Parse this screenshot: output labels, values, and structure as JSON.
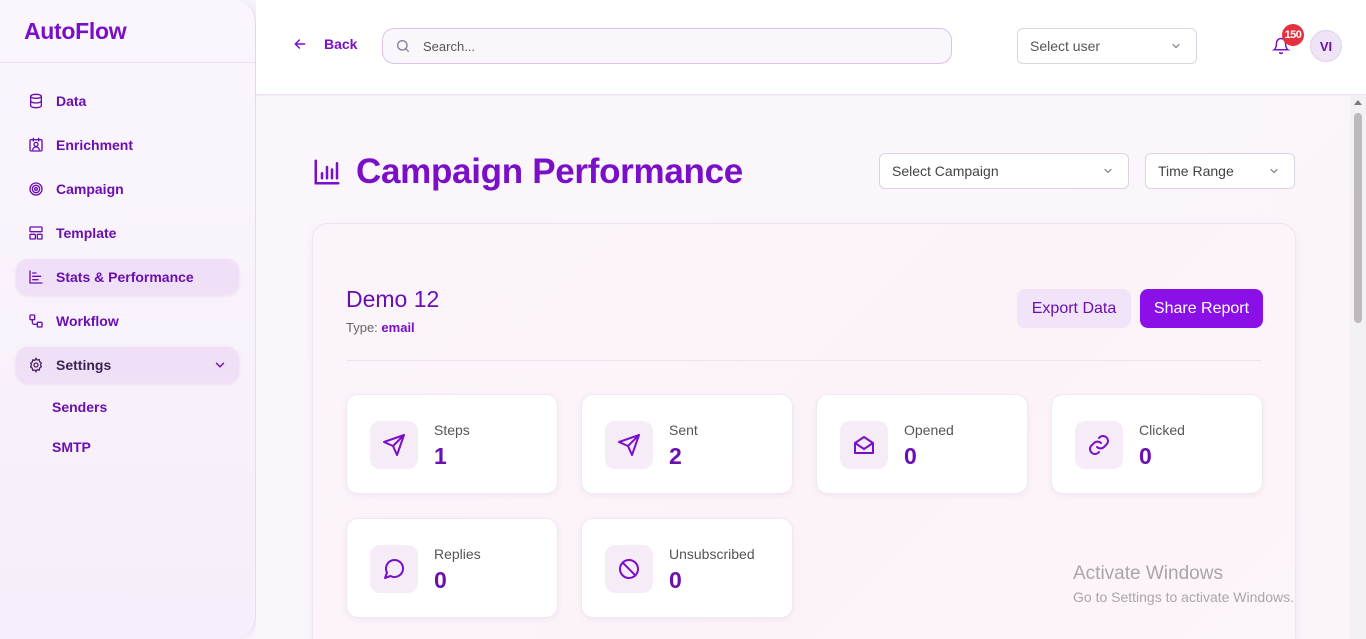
{
  "app": {
    "title": "AutoFlow"
  },
  "sidebar": {
    "items": [
      {
        "label": "Data",
        "icon": "database-icon"
      },
      {
        "label": "Enrichment",
        "icon": "id-card-icon"
      },
      {
        "label": "Campaign",
        "icon": "target-icon"
      },
      {
        "label": "Template",
        "icon": "layout-icon"
      },
      {
        "label": "Stats & Performance",
        "icon": "bar-chart-icon",
        "active": true
      },
      {
        "label": "Workflow",
        "icon": "workflow-icon"
      },
      {
        "label": "Settings",
        "icon": "gear-icon",
        "expanded": true
      }
    ],
    "settings_sub": [
      {
        "label": "Senders"
      },
      {
        "label": "SMTP"
      }
    ]
  },
  "topbar": {
    "back_label": "Back",
    "search_placeholder": "Search...",
    "select_user": "Select user",
    "notification_count": "150",
    "avatar_initials": "VI"
  },
  "page": {
    "title": "Campaign Performance",
    "select_campaign": "Select Campaign",
    "time_range": "Time Range"
  },
  "campaign": {
    "name": "Demo 12",
    "type_label": "Type:",
    "type_value": "email",
    "export_label": "Export Data",
    "share_label": "Share Report"
  },
  "stats": [
    {
      "label": "Steps",
      "value": "1",
      "icon": "send-icon"
    },
    {
      "label": "Sent",
      "value": "2",
      "icon": "send-icon"
    },
    {
      "label": "Opened",
      "value": "0",
      "icon": "mail-open-icon"
    },
    {
      "label": "Clicked",
      "value": "0",
      "icon": "link-icon"
    },
    {
      "label": "Replies",
      "value": "0",
      "icon": "message-circle-icon"
    },
    {
      "label": "Unsubscribed",
      "value": "0",
      "icon": "ban-icon"
    }
  ],
  "watermark": {
    "line1": "Activate Windows",
    "line2": "Go to Settings to activate Windows."
  },
  "colors": {
    "accent": "#7a0fc7",
    "primary_button": "#8b10e8",
    "badge": "#e5303e"
  }
}
